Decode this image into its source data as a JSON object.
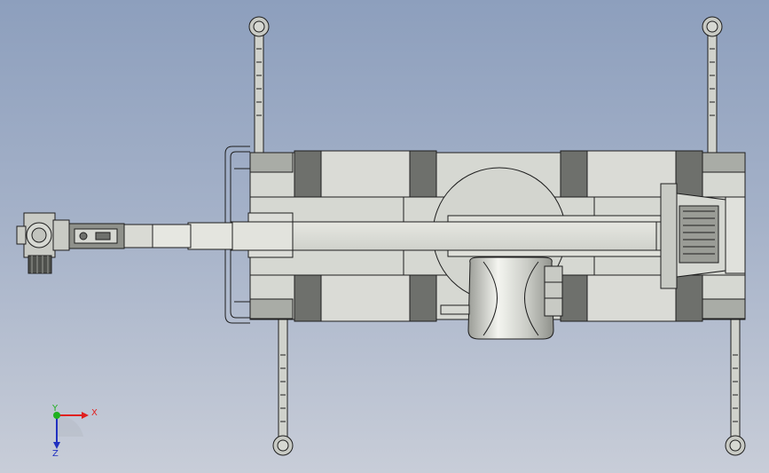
{
  "viewport": {
    "background_top": "#8d9fbd",
    "background_bottom": "#c8cdd8"
  },
  "model": {
    "body_color": "#d6d8d2",
    "shade_color": "#a9aca6",
    "dark_color": "#6e706c",
    "line_color": "#1e1e1e"
  },
  "triad": {
    "x_label": "X",
    "y_label": "Y",
    "z_label": "Z",
    "x_color": "#e02020",
    "y_color": "#20b020",
    "z_color": "#2030c0"
  }
}
